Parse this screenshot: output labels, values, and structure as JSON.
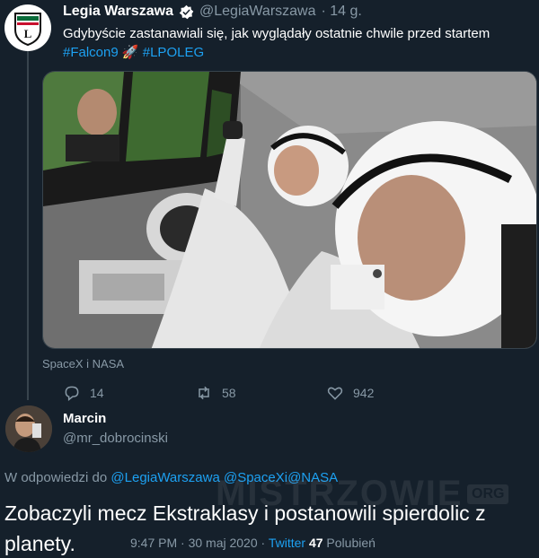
{
  "tweet": {
    "display_name": "Legia Warszawa",
    "handle": "@LegiaWarszawa",
    "age": "· 14 g.",
    "text": "Gdybyście zastanawiali się, jak wyglądały ostatnie chwile przed startem",
    "hashtag_1": "#Falcon9",
    "emoji": "🚀",
    "hashtag_2": "#LPOLEG",
    "media_credit": "SpaceX i NASA",
    "replies": "14",
    "retweets": "58",
    "likes": "942"
  },
  "reply": {
    "display_name": "Marcin",
    "handle": "@mr_dobrocinski",
    "reply_prefix": "W odpowiedzi do",
    "mention_1": "@LegiaWarszawa",
    "mention_2": "@SpaceX",
    "mention_joiner": "i",
    "mention_3": "@NASA",
    "text": "Zobaczyli mecz Ekstraklasy i postanowili spierdolic z planety.",
    "time": "9:47 PM · 30 maj 2020 ·",
    "via": "Twitter",
    "likes_count": "47",
    "likes_label": "Polubień"
  },
  "watermark": {
    "text": "MISTRZOWIE",
    "suffix": "ORG"
  },
  "colors": {
    "background": "#15202b",
    "accent": "#1da1f2",
    "muted": "#8899a6",
    "border": "#38444d"
  }
}
